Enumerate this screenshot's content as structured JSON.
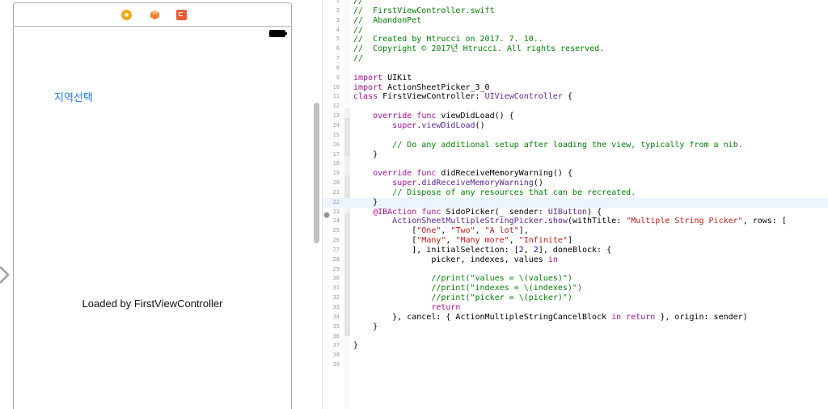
{
  "canvas": {
    "scene": {
      "dock_icons": [
        "view-controller-icon",
        "first-responder-icon",
        "exit-icon"
      ],
      "status_bar": {
        "battery_icon": "battery-icon"
      },
      "button_title": "지역선택",
      "center_label": "Loaded by FirstViewController"
    },
    "entry_point_icon": "entry-arrow-icon"
  },
  "editor": {
    "current_line": 22,
    "breakpoint_line": 23,
    "colors": {
      "comment": "#008400",
      "keyword": "#aa0d91",
      "type": "#5c2699",
      "string": "#c41a16",
      "number": "#1c00cf",
      "current_line_bg": "#ecf5ff",
      "accent": "#1f7aff"
    },
    "lines": [
      [
        {
          "t": "//",
          "c": "comment"
        }
      ],
      [
        {
          "t": "//  FirstViewController.swift",
          "c": "comment"
        }
      ],
      [
        {
          "t": "//  AbandonPet",
          "c": "comment"
        }
      ],
      [
        {
          "t": "//",
          "c": "comment"
        }
      ],
      [
        {
          "t": "//  Created by Htrucci on 2017. 7. 10..",
          "c": "comment"
        }
      ],
      [
        {
          "t": "//  Copyright © 2017년 Htrucci. All rights reserved.",
          "c": "comment"
        }
      ],
      [
        {
          "t": "//",
          "c": "comment"
        }
      ],
      [],
      [
        {
          "t": "import",
          "c": "keyword"
        },
        {
          "t": " UIKit"
        }
      ],
      [
        {
          "t": "import",
          "c": "keyword"
        },
        {
          "t": " ActionSheetPicker_3_0"
        }
      ],
      [
        {
          "t": "class",
          "c": "keyword"
        },
        {
          "t": " FirstViewController: "
        },
        {
          "t": "UIViewController",
          "c": "type"
        },
        {
          "t": " {"
        }
      ],
      [],
      [
        {
          "t": "    "
        },
        {
          "t": "override",
          "c": "keyword"
        },
        {
          "t": " "
        },
        {
          "t": "func",
          "c": "keyword"
        },
        {
          "t": " viewDidLoad() {"
        }
      ],
      [
        {
          "t": "        "
        },
        {
          "t": "super",
          "c": "keyword"
        },
        {
          "t": "."
        },
        {
          "t": "viewDidLoad",
          "c": "type"
        },
        {
          "t": "()"
        }
      ],
      [],
      [
        {
          "t": "        "
        },
        {
          "t": "// Do any additional setup after loading the view, typically from a nib.",
          "c": "comment"
        }
      ],
      [
        {
          "t": "    }"
        }
      ],
      [],
      [
        {
          "t": "    "
        },
        {
          "t": "override",
          "c": "keyword"
        },
        {
          "t": " "
        },
        {
          "t": "func",
          "c": "keyword"
        },
        {
          "t": " didReceiveMemoryWarning() {"
        }
      ],
      [
        {
          "t": "        "
        },
        {
          "t": "super",
          "c": "keyword"
        },
        {
          "t": "."
        },
        {
          "t": "didReceiveMemoryWarning",
          "c": "type"
        },
        {
          "t": "()"
        }
      ],
      [
        {
          "t": "        "
        },
        {
          "t": "// Dispose of any resources that can be recreated.",
          "c": "comment"
        }
      ],
      [
        {
          "t": "    }"
        }
      ],
      [
        {
          "t": "    "
        },
        {
          "t": "@IBAction",
          "c": "keyword"
        },
        {
          "t": " "
        },
        {
          "t": "func",
          "c": "keyword"
        },
        {
          "t": " SidoPicker(_ sender: "
        },
        {
          "t": "UIButton",
          "c": "type"
        },
        {
          "t": ") {"
        }
      ],
      [
        {
          "t": "        "
        },
        {
          "t": "ActionSheetMultipleStringPicker",
          "c": "type"
        },
        {
          "t": "."
        },
        {
          "t": "show",
          "c": "type"
        },
        {
          "t": "(withTitle: "
        },
        {
          "t": "\"Multiple String Picker\"",
          "c": "string"
        },
        {
          "t": ", rows: ["
        }
      ],
      [
        {
          "t": "            ["
        },
        {
          "t": "\"One\"",
          "c": "string"
        },
        {
          "t": ", "
        },
        {
          "t": "\"Two\"",
          "c": "string"
        },
        {
          "t": ", "
        },
        {
          "t": "\"A lot\"",
          "c": "string"
        },
        {
          "t": "],"
        }
      ],
      [
        {
          "t": "            ["
        },
        {
          "t": "\"Many\"",
          "c": "string"
        },
        {
          "t": ", "
        },
        {
          "t": "\"Many more\"",
          "c": "string"
        },
        {
          "t": ", "
        },
        {
          "t": "\"Infinite\"",
          "c": "string"
        },
        {
          "t": "]"
        }
      ],
      [
        {
          "t": "            ], initialSelection: ["
        },
        {
          "t": "2",
          "c": "number"
        },
        {
          "t": ", "
        },
        {
          "t": "2",
          "c": "number"
        },
        {
          "t": "], doneBlock: {"
        }
      ],
      [
        {
          "t": "                picker, indexes, values "
        },
        {
          "t": "in",
          "c": "keyword"
        }
      ],
      [],
      [
        {
          "t": "                "
        },
        {
          "t": "//print(\"values = \\(values)\")",
          "c": "comment"
        }
      ],
      [
        {
          "t": "                "
        },
        {
          "t": "//print(\"indexes = \\(indexes)\")",
          "c": "comment"
        }
      ],
      [
        {
          "t": "                "
        },
        {
          "t": "//print(\"picker = \\(picker)\")",
          "c": "comment"
        }
      ],
      [
        {
          "t": "                "
        },
        {
          "t": "return",
          "c": "keyword"
        }
      ],
      [
        {
          "t": "        }, cancel: { ActionMultipleStringCancelBlock "
        },
        {
          "t": "in",
          "c": "keyword"
        },
        {
          "t": " "
        },
        {
          "t": "return",
          "c": "keyword"
        },
        {
          "t": " }, origin: sender)"
        }
      ],
      [
        {
          "t": "    }"
        }
      ],
      [],
      [
        {
          "t": "}"
        }
      ],
      [],
      []
    ]
  }
}
